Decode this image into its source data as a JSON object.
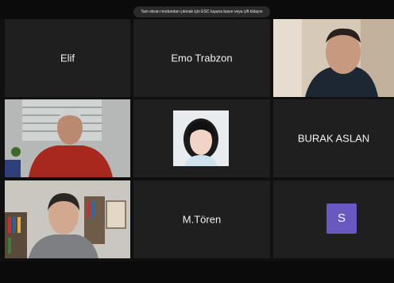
{
  "banner": {
    "text": "Tam ekran modundan çıkmak için ESC tuşuna basın veya çift tıklayın"
  },
  "participants": {
    "p1": {
      "name": "Elif"
    },
    "p2": {
      "name": "Emo Trabzon"
    },
    "p3": {
      "name": ""
    },
    "p4": {
      "name": ""
    },
    "p5": {
      "name": ""
    },
    "p6": {
      "name": "BURAK ASLAN"
    },
    "p7": {
      "name": ""
    },
    "p8": {
      "name": "M.Tören"
    },
    "p9": {
      "avatar_letter": "S",
      "avatar_color": "#6a58c2"
    }
  }
}
